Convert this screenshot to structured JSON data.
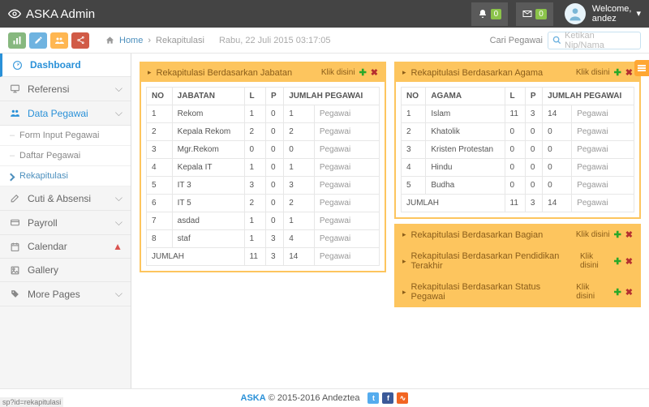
{
  "brand": "ASKA Admin",
  "notifs": {
    "bell_count": "0",
    "mail_count": "0"
  },
  "user": {
    "welcome": "Welcome,",
    "name": "andez"
  },
  "breadcrumb": {
    "home": "Home",
    "current": "Rekapitulasi",
    "date": "Rabu, 22 Juli 2015 03:17:05"
  },
  "search": {
    "label": "Cari Pegawai",
    "placeholder": "Ketikan Nip/Nama"
  },
  "sidebar": {
    "items": [
      {
        "label": "Dashboard"
      },
      {
        "label": "Referensi"
      },
      {
        "label": "Data Pegawai"
      },
      {
        "label": "Cuti & Absensi"
      },
      {
        "label": "Payroll"
      },
      {
        "label": "Calendar"
      },
      {
        "label": "Gallery"
      },
      {
        "label": "More Pages"
      }
    ],
    "sub": [
      {
        "label": "Form Input Pegawai"
      },
      {
        "label": "Daftar Pegawai"
      },
      {
        "label": "Rekapitulasi"
      }
    ]
  },
  "klik": "Klik disini",
  "panel1": {
    "title": "Rekapitulasi Berdasarkan Jabatan",
    "headers": {
      "no": "NO",
      "col": "JABATAN",
      "l": "L",
      "p": "P",
      "jml": "JUMLAH PEGAWAI"
    },
    "rows": [
      {
        "no": "1",
        "col": "Rekom",
        "l": "1",
        "p": "0",
        "j": "1",
        "t": "Pegawai"
      },
      {
        "no": "2",
        "col": "Kepala Rekom",
        "l": "2",
        "p": "0",
        "j": "2",
        "t": "Pegawai"
      },
      {
        "no": "3",
        "col": "Mgr.Rekom",
        "l": "0",
        "p": "0",
        "j": "0",
        "t": "Pegawai"
      },
      {
        "no": "4",
        "col": "Kepala IT",
        "l": "1",
        "p": "0",
        "j": "1",
        "t": "Pegawai"
      },
      {
        "no": "5",
        "col": "IT 3",
        "l": "3",
        "p": "0",
        "j": "3",
        "t": "Pegawai"
      },
      {
        "no": "6",
        "col": "IT 5",
        "l": "2",
        "p": "0",
        "j": "2",
        "t": "Pegawai"
      },
      {
        "no": "7",
        "col": "asdad",
        "l": "1",
        "p": "0",
        "j": "1",
        "t": "Pegawai"
      },
      {
        "no": "8",
        "col": "staf",
        "l": "1",
        "p": "3",
        "j": "4",
        "t": "Pegawai"
      }
    ],
    "total": {
      "label": "JUMLAH",
      "l": "11",
      "p": "3",
      "j": "14",
      "t": "Pegawai"
    }
  },
  "panel2": {
    "title": "Rekapitulasi Berdasarkan Agama",
    "headers": {
      "no": "NO",
      "col": "AGAMA",
      "l": "L",
      "p": "P",
      "jml": "JUMLAH PEGAWAI"
    },
    "rows": [
      {
        "no": "1",
        "col": "Islam",
        "l": "11",
        "p": "3",
        "j": "14",
        "t": "Pegawai"
      },
      {
        "no": "2",
        "col": "Khatolik",
        "l": "0",
        "p": "0",
        "j": "0",
        "t": "Pegawai"
      },
      {
        "no": "3",
        "col": "Kristen Protestan",
        "l": "0",
        "p": "0",
        "j": "0",
        "t": "Pegawai"
      },
      {
        "no": "4",
        "col": "Hindu",
        "l": "0",
        "p": "0",
        "j": "0",
        "t": "Pegawai"
      },
      {
        "no": "5",
        "col": "Budha",
        "l": "0",
        "p": "0",
        "j": "0",
        "t": "Pegawai"
      }
    ],
    "total": {
      "label": "JUMLAH",
      "l": "11",
      "p": "3",
      "j": "14",
      "t": "Pegawai"
    }
  },
  "collapsed": [
    {
      "title": "Rekapitulasi Berdasarkan Bagian"
    },
    {
      "title": "Rekapitulasi Berdasarkan Pendidikan Terakhir"
    },
    {
      "title": "Rekapitulasi Berdasarkan Status Pegawai"
    }
  ],
  "footer": {
    "brand": "ASKA",
    "text": " © 2015-2016 Andeztea"
  },
  "status": "sp?id=rekapitulasi"
}
